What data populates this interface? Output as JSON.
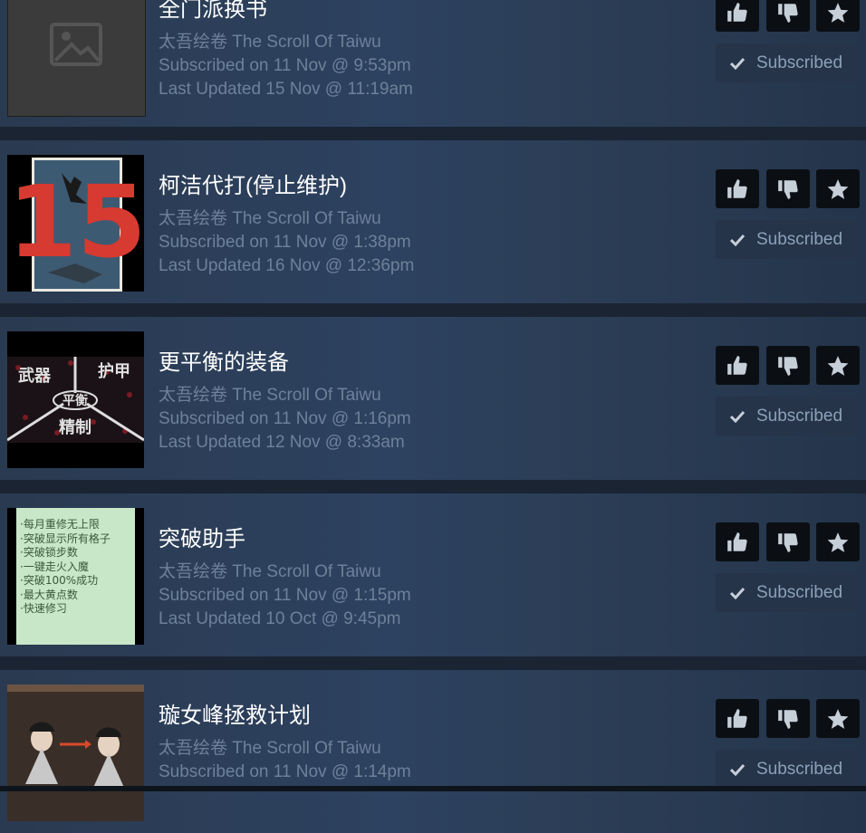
{
  "items": [
    {
      "title": "全门派换书",
      "game": "太吾绘卷 The Scroll Of Taiwu",
      "subscribed": "Subscribed on 11 Nov @ 9:53pm",
      "updated": "Last Updated 15 Nov @ 11:19am",
      "thumb_icon": "image-placeholder-icon"
    },
    {
      "title": "柯洁代打(停止维护)",
      "game": "太吾绘卷 The Scroll Of Taiwu",
      "subscribed": "Subscribed on 11 Nov @ 1:38pm",
      "updated": "Last Updated 16 Nov @ 12:36pm",
      "thumb_text": "15"
    },
    {
      "title": "更平衡的装备",
      "game": "太吾绘卷 The Scroll Of Taiwu",
      "subscribed": "Subscribed on 11 Nov @ 1:16pm",
      "updated": "Last Updated 12 Nov @ 8:33am",
      "thumb_words": [
        "武器",
        "护甲",
        "平衡",
        "精制"
      ]
    },
    {
      "title": "突破助手",
      "game": "太吾绘卷 The Scroll Of Taiwu",
      "subscribed": "Subscribed on 11 Nov @ 1:15pm",
      "updated": "Last Updated 10 Oct @ 9:45pm",
      "thumb_lines": [
        "·每月重修无上限",
        "·突破显示所有格子",
        "·突破锁步数",
        "·一键走火入魔",
        "·突破100%成功",
        "·最大黄点数",
        "·快速修习"
      ]
    },
    {
      "title": "璇女峰拯救计划",
      "game": "太吾绘卷 The Scroll Of Taiwu",
      "subscribed": "Subscribed on 11 Nov @ 1:14pm",
      "updated": ""
    }
  ],
  "buttons": {
    "upvote_icon": "thumbs-up-icon",
    "downvote_icon": "thumbs-down-icon",
    "favorite_icon": "star-icon",
    "subscribed_label": "Subscribed",
    "check_icon": "checkmark-icon"
  },
  "colors": {
    "background": "#1b2838",
    "title": "#ffffff",
    "meta": "#6d819a",
    "button_dark": "#0b0f14",
    "subscribed_button": "#253449"
  }
}
